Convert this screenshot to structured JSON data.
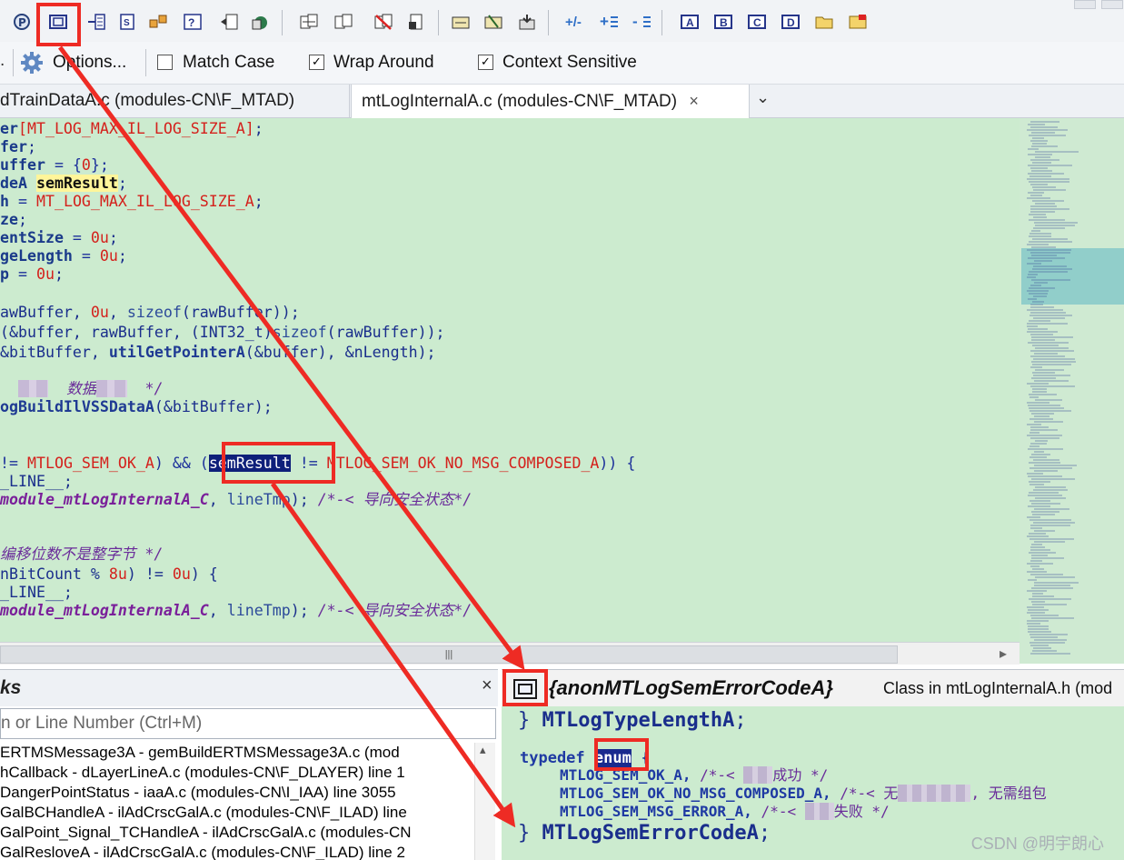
{
  "toolbar": {
    "icons": [
      "project-icon",
      "class-icon",
      "relation-icon",
      "file-icon",
      "symbol-icon",
      "help-icon",
      "hierarchy-icon",
      "reference-icon",
      "copy-icon",
      "sync-icon",
      "delete-icon",
      "lock-icon",
      "fit-icon",
      "browse-icon",
      "export-icon",
      "plus-minus-icon",
      "expand-icon",
      "collapse-icon",
      "A",
      "B",
      "C",
      "D",
      "folder-icon",
      "ab-icon"
    ]
  },
  "search_bar": {
    "options_label": "Options...",
    "match_case": {
      "label": "Match Case",
      "checked": false
    },
    "wrap_around": {
      "label": "Wrap Around",
      "checked": true
    },
    "context_sensitive": {
      "label": "Context Sensitive",
      "checked": true
    }
  },
  "tabs": [
    {
      "label": "dTrainDataA.c (modules-CN\\F_MTAD)",
      "active": false
    },
    {
      "label": "mtLogInternalA.c (modules-CN\\F_MTAD)",
      "active": true
    }
  ],
  "editor": {
    "lines": [
      {
        "parts": [
          [
            "id",
            "er"
          ],
          [
            "mac",
            "[MT_LOG_MAX_IL_LOG_SIZE_A]"
          ],
          [
            "plain",
            ";"
          ]
        ]
      },
      {
        "parts": [
          [
            "id",
            "fer"
          ],
          [
            "plain",
            ";"
          ]
        ]
      },
      {
        "parts": [
          [
            "id",
            "uffer"
          ],
          [
            "op",
            " = {"
          ],
          [
            "num",
            "0"
          ],
          [
            "op",
            "};"
          ]
        ]
      },
      {
        "parts": [
          [
            "id",
            "deA "
          ],
          [
            "hl",
            "semResult"
          ],
          [
            "plain",
            ";"
          ]
        ]
      },
      {
        "parts": [
          [
            "id",
            "h"
          ],
          [
            "op",
            " = "
          ],
          [
            "mac",
            "MT_LOG_MAX_IL_LOG_SIZE_A"
          ],
          [
            "plain",
            ";"
          ]
        ]
      },
      {
        "parts": [
          [
            "id",
            "ze"
          ],
          [
            "plain",
            ";"
          ]
        ]
      },
      {
        "parts": [
          [
            "id",
            "entSize"
          ],
          [
            "op",
            " = "
          ],
          [
            "num",
            "0u"
          ],
          [
            "plain",
            ";"
          ]
        ]
      },
      {
        "parts": [
          [
            "id",
            "geLength"
          ],
          [
            "op",
            " = "
          ],
          [
            "num",
            "0u"
          ],
          [
            "plain",
            ";"
          ]
        ]
      },
      {
        "parts": [
          [
            "id",
            "p"
          ],
          [
            "op",
            " = "
          ],
          [
            "num",
            "0u"
          ],
          [
            "plain",
            ";"
          ]
        ]
      },
      {
        "parts": []
      },
      {
        "parts": [
          [
            "plain",
            "awBuffer, "
          ],
          [
            "num",
            "0u"
          ],
          [
            "plain",
            ", "
          ],
          [
            "sizeof",
            "sizeof"
          ],
          [
            "plain",
            "(rawBuffer));"
          ]
        ]
      },
      {
        "parts": [
          [
            "plain",
            "(&buffer, rawBuffer, (INT32_t)"
          ],
          [
            "sizeof",
            "sizeof"
          ],
          [
            "plain",
            "(rawBuffer));"
          ]
        ]
      },
      {
        "parts": [
          [
            "plain",
            "&bitBuffer, "
          ],
          [
            "fn",
            "utilGetPointerA"
          ],
          [
            "plain",
            "(&buffer), &nLength);"
          ]
        ]
      },
      {
        "parts": []
      },
      {
        "parts": [
          [
            "cmt",
            "  "
          ],
          [
            "blur",
            "编码"
          ],
          [
            "cmt",
            "  数据"
          ],
          [
            "blur",
            "编码"
          ],
          [
            "cmt",
            "  */"
          ]
        ]
      },
      {
        "parts": [
          [
            "fn",
            "ogBuildIlVSSDataA"
          ],
          [
            "plain",
            "(&bitBuffer);"
          ]
        ]
      },
      {
        "parts": []
      },
      {
        "parts": []
      },
      {
        "parts": [
          [
            "op",
            "!= "
          ],
          [
            "mac",
            "MTLOG_SEM_OK_A"
          ],
          [
            "op",
            ") && ("
          ],
          [
            "hlsel",
            "semResult"
          ],
          [
            "op",
            " != "
          ],
          [
            "mac",
            "MTLOG_SEM_OK_NO_MSG_COMPOSED_A"
          ],
          [
            "op",
            ")) {"
          ]
        ]
      },
      {
        "parts": [
          [
            "plain",
            "_LINE__;"
          ]
        ]
      },
      {
        "parts": [
          [
            "func",
            "module_mtLogInternalA_C"
          ],
          [
            "plain",
            ", "
          ],
          [
            "sizeof",
            "lineTmp"
          ],
          [
            "plain",
            "); "
          ],
          [
            "cmt",
            "/*-< 导向安全状态*/"
          ]
        ]
      },
      {
        "parts": []
      },
      {
        "parts": []
      },
      {
        "parts": [
          [
            "cmt",
            "编移位数不是整字节 */"
          ]
        ]
      },
      {
        "parts": [
          [
            "plain",
            "nBitCount % "
          ],
          [
            "num",
            "8u"
          ],
          [
            "plain",
            ") != "
          ],
          [
            "num",
            "0u"
          ],
          [
            "plain",
            ") {"
          ]
        ]
      },
      {
        "parts": [
          [
            "plain",
            "_LINE__;"
          ]
        ]
      },
      {
        "parts": [
          [
            "func",
            "module_mtLogInternalA_C"
          ],
          [
            "plain",
            ", "
          ],
          [
            "sizeof",
            "lineTmp"
          ],
          [
            "plain",
            "); "
          ],
          [
            "cmt",
            "/*-< 导向安全状态*/"
          ]
        ]
      }
    ]
  },
  "symbol_panel": {
    "title": "ks",
    "close": "×",
    "search_placeholder": "n or Line Number (Ctrl+M)",
    "rows": [
      "ERTMSMessage3A - gemBuildERTMSMessage3A.c (mod",
      "hCallback - dLayerLineA.c (modules-CN\\F_DLAYER) line 1",
      "DangerPointStatus - iaaA.c (modules-CN\\I_IAA) line 3055",
      "GalBCHandleA - ilAdCrscGalA.c (modules-CN\\F_ILAD) line",
      "GalPoint_Signal_TCHandleA - ilAdCrscGalA.c (modules-CN",
      "GalResloveA - ilAdCrscGalA.c (modules-CN\\F_ILAD) line 2"
    ]
  },
  "context_panel": {
    "symbol_name": "{anonMTLogSemErrorCodeA}",
    "symbol_desc": "Class in mtLogInternalA.h (mod",
    "line1_brace": "}",
    "line1_name": "MTLogTypeLengthA",
    "typedef_kw": "typedef",
    "enum_kw": "enum",
    "open_brace": "{",
    "enum_items": [
      {
        "name": "MTLOG_SEM_OK_A,",
        "comment": "/*-< ",
        "blur": "组包",
        "comment2": "成功 */"
      },
      {
        "name": "MTLOG_SEM_OK_NO_MSG_COMPOSED_A,",
        "comment": "/*-< 无",
        "blur": "需组包数据",
        "comment2": ", 无需组包"
      },
      {
        "name": "MTLOG_SEM_MSG_ERROR_A,",
        "comment": "/*-< ",
        "blur": "组包",
        "comment2": "失败 */"
      }
    ],
    "last_brace": "}",
    "last_name": "MTLogSemErrorCodeA",
    "semicolon": ";"
  },
  "watermark": "CSDN @明宇朗心",
  "scroll_thumb": "|||",
  "scroll_arrow": "▸",
  "tab_close": "×",
  "tab_dropdown": "⌄"
}
